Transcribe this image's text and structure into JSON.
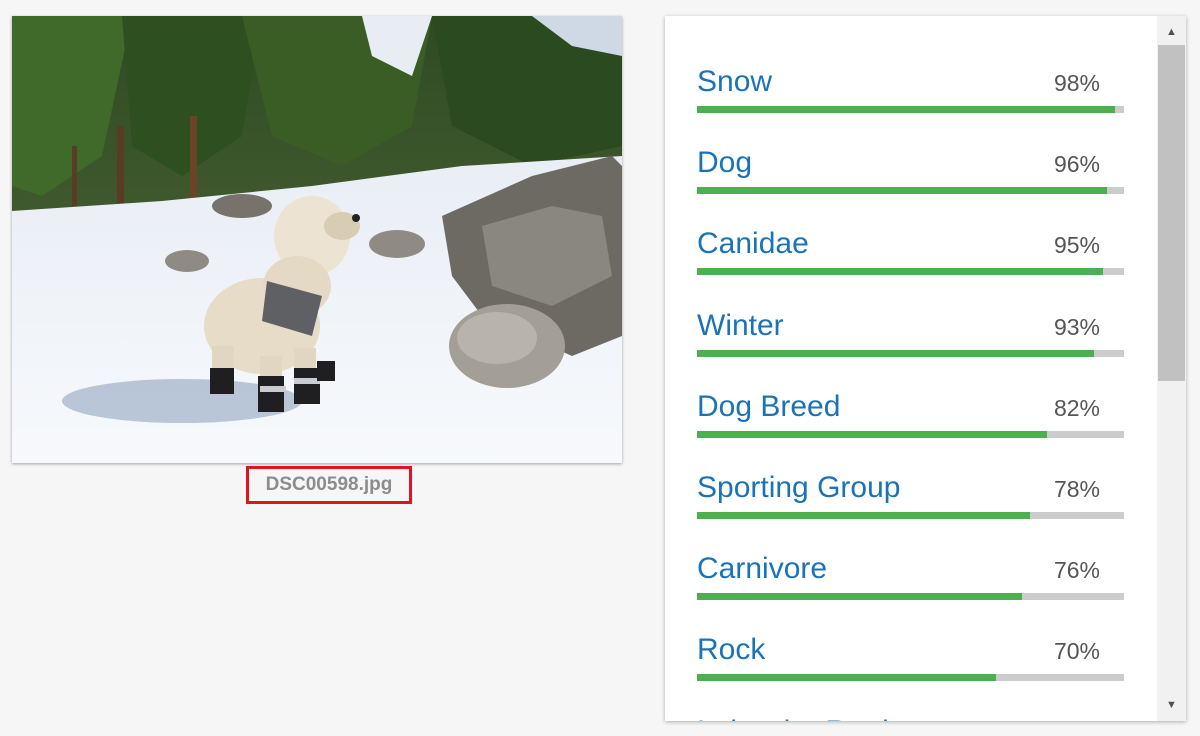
{
  "photo": {
    "filename": "DSC00598.jpg",
    "subject": "dog-in-snow-photo"
  },
  "labels": [
    {
      "name": "Snow",
      "percent_text": "98%",
      "confidence": 0.98
    },
    {
      "name": "Dog",
      "percent_text": "96%",
      "confidence": 0.96
    },
    {
      "name": "Canidae",
      "percent_text": "95%",
      "confidence": 0.95
    },
    {
      "name": "Winter",
      "percent_text": "93%",
      "confidence": 0.93
    },
    {
      "name": "Dog Breed",
      "percent_text": "82%",
      "confidence": 0.82
    },
    {
      "name": "Sporting Group",
      "percent_text": "78%",
      "confidence": 0.78
    },
    {
      "name": "Carnivore",
      "percent_text": "76%",
      "confidence": 0.76
    },
    {
      "name": "Rock",
      "percent_text": "70%",
      "confidence": 0.7
    },
    {
      "name": "Labrador Retriever",
      "percent_text": "",
      "confidence": null
    }
  ],
  "colors": {
    "label_text": "#1a73b8",
    "bar_fill": "#4caf50",
    "bar_track": "#cccccc",
    "highlight_border": "#e0141e"
  },
  "icons": {
    "scroll_up": "▲",
    "scroll_down": "▼"
  }
}
